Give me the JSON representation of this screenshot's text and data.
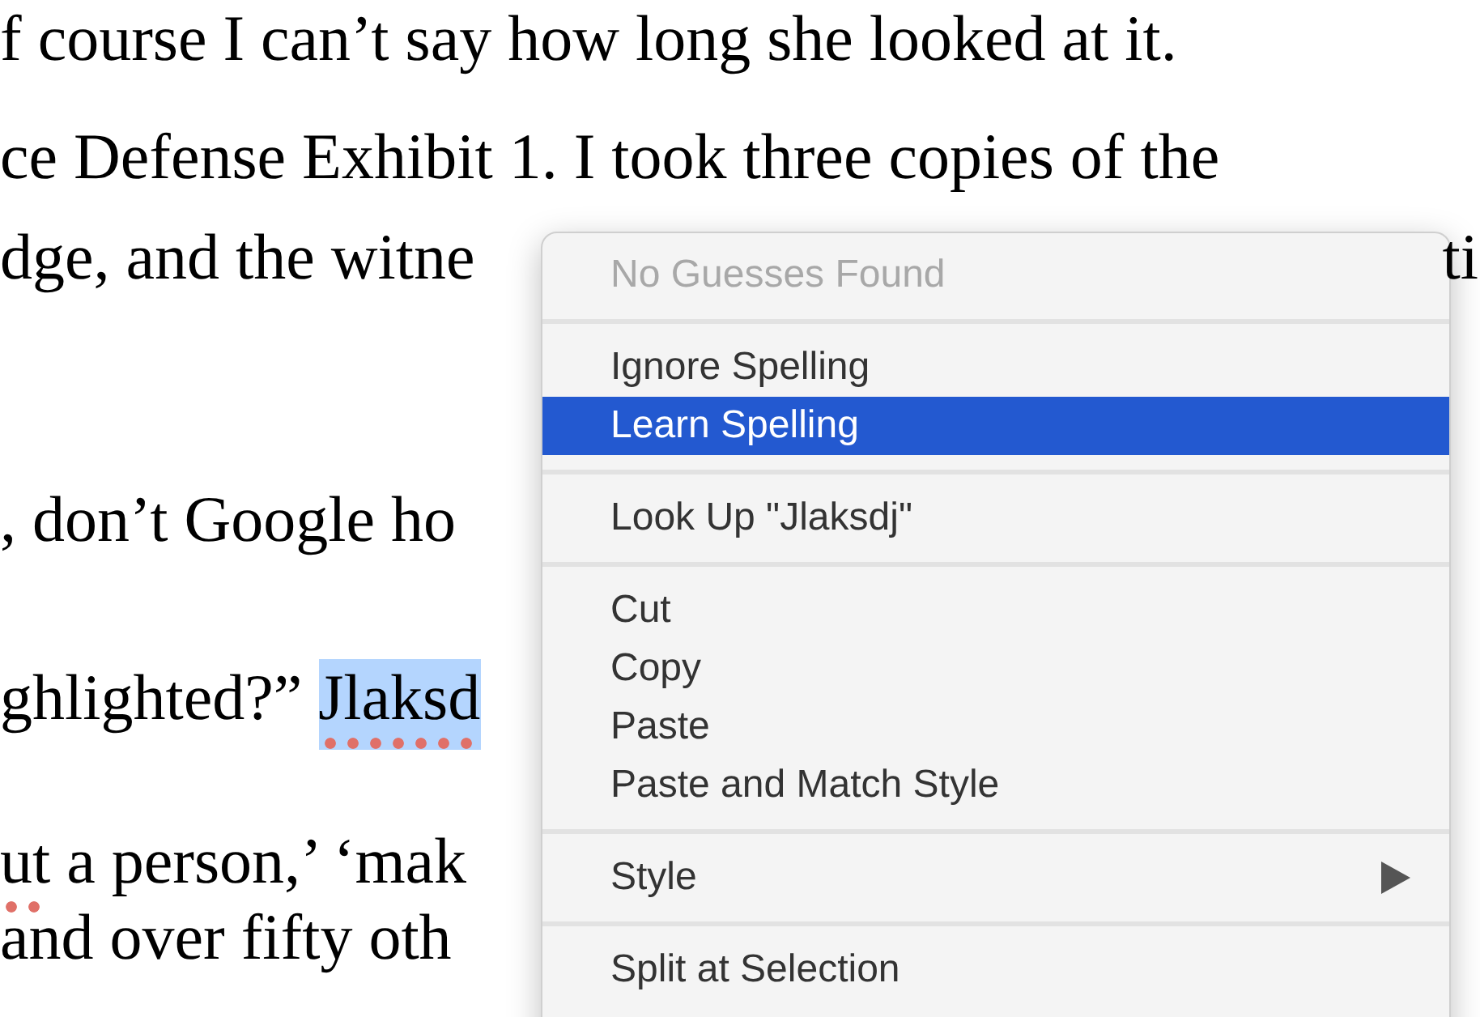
{
  "document": {
    "lines": [
      {
        "segments": [
          {
            "text": "f course I can’t say how long she looked at it.",
            "misspelled": false,
            "selected": false
          }
        ]
      },
      {
        "segments": [
          {
            "text": "ce Defense Exhibit 1. I took three copies of the",
            "misspelled": false,
            "selected": false
          }
        ]
      },
      {
        "segments": [
          {
            "text": "dge, and the witne",
            "misspelled": false,
            "selected": false
          }
        ],
        "right": "ti"
      },
      {
        "segments": [
          {
            "text": ", don’t Google ho",
            "misspelled": false,
            "selected": false
          }
        ]
      },
      {
        "segments": [
          {
            "text": "ghlighted?” ",
            "misspelled": false,
            "selected": false
          },
          {
            "text": "Jlaksd",
            "misspelled": true,
            "selected": true
          }
        ]
      },
      {
        "segments": [
          {
            "text": "ut",
            "misspelled": true,
            "selected": false
          },
          {
            "text": " a person,’ ‘mak",
            "misspelled": false,
            "selected": false
          }
        ]
      },
      {
        "segments": [
          {
            "text": "and over fifty oth",
            "misspelled": false,
            "selected": false
          }
        ]
      }
    ]
  },
  "context_menu": {
    "items": [
      {
        "kind": "item",
        "label": "No Guesses Found",
        "disabled": true,
        "selected": false
      },
      {
        "kind": "separator"
      },
      {
        "kind": "item",
        "label": "Ignore Spelling",
        "disabled": false,
        "selected": false
      },
      {
        "kind": "item",
        "label": "Learn Spelling",
        "disabled": false,
        "selected": true
      },
      {
        "kind": "separator"
      },
      {
        "kind": "item",
        "label": "Look Up \"Jlaksdj\"",
        "disabled": false,
        "selected": false
      },
      {
        "kind": "separator"
      },
      {
        "kind": "item",
        "label": "Cut",
        "disabled": false,
        "selected": false
      },
      {
        "kind": "item",
        "label": "Copy",
        "disabled": false,
        "selected": false
      },
      {
        "kind": "item",
        "label": "Paste",
        "disabled": false,
        "selected": false
      },
      {
        "kind": "item",
        "label": "Paste and Match Style",
        "disabled": false,
        "selected": false
      },
      {
        "kind": "separator"
      },
      {
        "kind": "item",
        "label": "Style",
        "disabled": false,
        "selected": false,
        "submenu": true
      },
      {
        "kind": "separator"
      },
      {
        "kind": "item",
        "label": "Split at Selection",
        "disabled": false,
        "selected": false
      }
    ]
  }
}
